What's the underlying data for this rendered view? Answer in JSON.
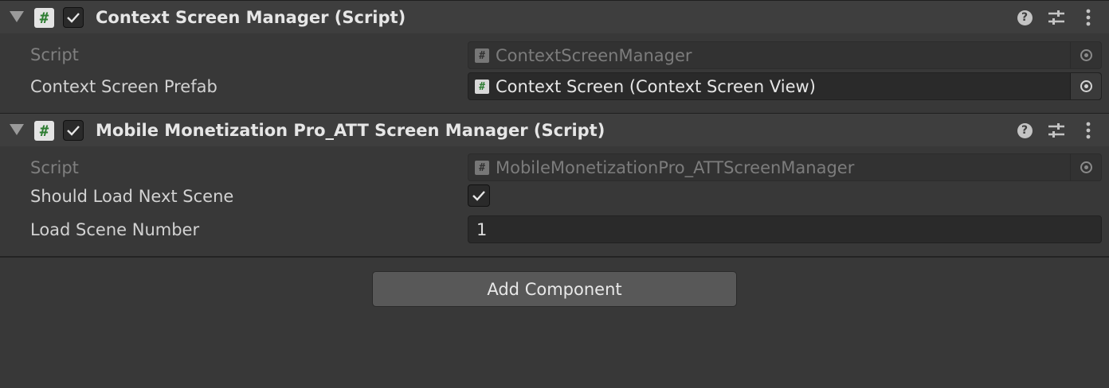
{
  "components": [
    {
      "title": "Context Screen Manager (Script)",
      "enabled": true,
      "script_label": "Script",
      "script_value": "ContextScreenManager",
      "prefab_label": "Context Screen Prefab",
      "prefab_value": "Context Screen (Context Screen View)"
    },
    {
      "title": "Mobile Monetization Pro_ATT Screen Manager (Script)",
      "enabled": true,
      "script_label": "Script",
      "script_value": "MobileMonetizationPro_ATTScreenManager",
      "load_next_label": "Should Load Next Scene",
      "load_next_value": true,
      "scene_number_label": "Load Scene Number",
      "scene_number_value": "1"
    }
  ],
  "icons": {
    "script": "#",
    "help": "?",
    "foldout": "triangle-down-icon",
    "presets": "sliders-icon",
    "menu": "kebab-menu-icon",
    "object_picker": "target-icon"
  },
  "add_component_label": "Add Component",
  "colors": {
    "background": "#383838",
    "header": "#3e3e3e",
    "field": "#2a2a2a",
    "button": "#585858",
    "script_icon_hash": "#2e7d32"
  }
}
